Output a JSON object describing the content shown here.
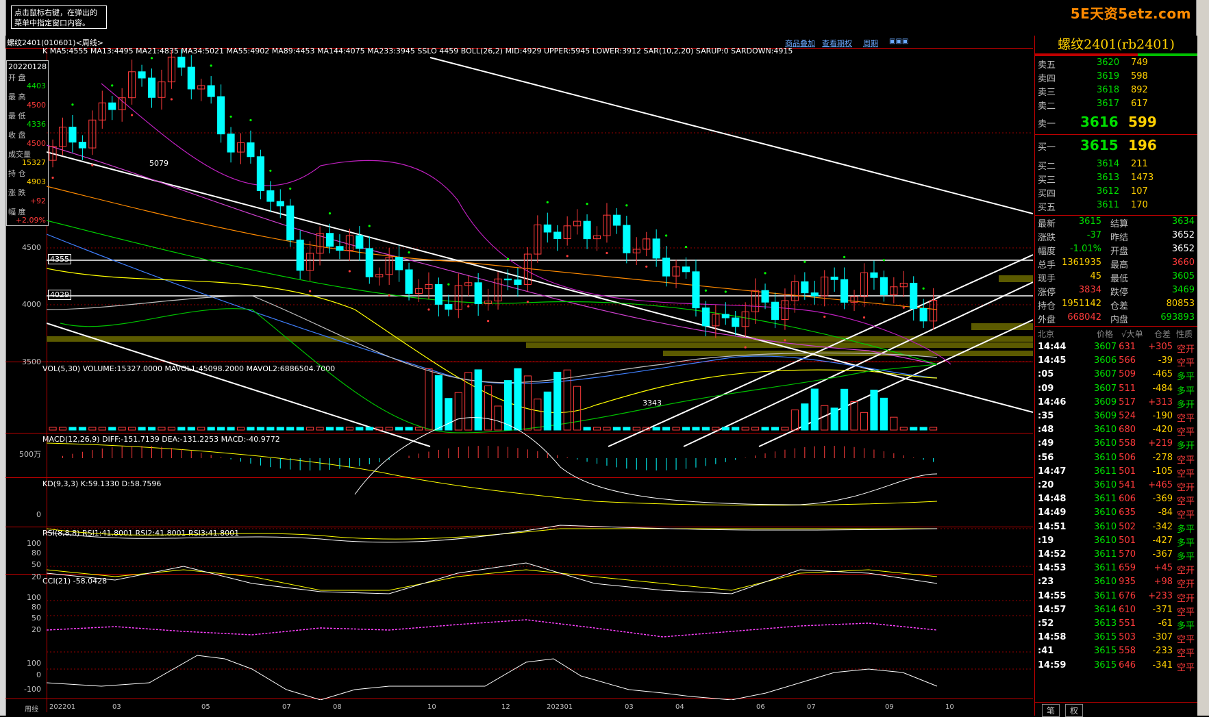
{
  "tip": {
    "text": "点击鼠标右键，在弹出的菜单中指定窗口内容。"
  },
  "logo": "5E天资5etz.com",
  "titlebar": {
    "title": "螺纹2401(010601)<周线>",
    "links": [
      "商品叠加",
      "查看期权",
      "周期"
    ]
  },
  "indicators": {
    "main": "K  MA5:4555  MA13:4495  MA21:4835  MA34:5021  MA55:4902  MA89:4453  MA144:4075  MA233:3945  SSLO 4459  BOLL(26,2)  MID:4929  UPPER:5945  LOWER:3912  SAR(10,2,20)  SARUP:0  SARDOWN:4915",
    "vol": "VOL(5,30)  VOLUME:15327.0000  MAVOL1:45098.2000  MAVOL2:6886504.7000",
    "macd": "MACD(12,26,9)  DIFF:-151.7139  DEA:-131.2253  MACD:-40.9772",
    "kd": "KD(9,3,3)  K:59.1330  D:58.7596",
    "rsi": "RSI(8,8,8)  RSI1:41.8001  RSI2:41.8001  RSI3:41.8001",
    "cci": "CCI(21)  -58.0428"
  },
  "infobox": {
    "date": "20220128",
    "rows": [
      {
        "label": "开  盘",
        "value": "4403"
      },
      {
        "label": "最  高",
        "value": "4500"
      },
      {
        "label": "最  低",
        "value": "4336"
      },
      {
        "label": "收  盘",
        "value": "4500"
      },
      {
        "label": "成交量",
        "value": "15327"
      },
      {
        "label": "持  仓",
        "value": "4903"
      },
      {
        "label": "涨  跌",
        "value": "+92"
      },
      {
        "label": "幅  度",
        "value": "+2.09%"
      }
    ]
  },
  "price_axis": [
    "4500",
    "4000",
    "3500"
  ],
  "price_tags": [
    "4355",
    "4029"
  ],
  "chart_annotations": [
    "5079",
    "3343"
  ],
  "vol_axis": "500万",
  "macd_axis": "0",
  "kd_axis": [
    "100",
    "80",
    "50",
    "20"
  ],
  "rsi_axis": [
    "100",
    "80",
    "50",
    "20"
  ],
  "cci_axis": [
    "100",
    "0",
    "-100"
  ],
  "time_axis": [
    "202201",
    "03",
    "05",
    "07",
    "08",
    "10",
    "12",
    "202301",
    "03",
    "04",
    "06",
    "07",
    "09",
    "10"
  ],
  "time_axis_label": "周线",
  "right_panel": {
    "title": "螺纹2401(rb2401)",
    "asks": [
      {
        "label": "卖五",
        "price": "3620",
        "vol": "749"
      },
      {
        "label": "卖四",
        "price": "3619",
        "vol": "598"
      },
      {
        "label": "卖三",
        "price": "3618",
        "vol": "892"
      },
      {
        "label": "卖二",
        "price": "3617",
        "vol": "617"
      },
      {
        "label": "卖一",
        "price": "3616",
        "vol": "599"
      }
    ],
    "bids": [
      {
        "label": "买一",
        "price": "3615",
        "vol": "196"
      },
      {
        "label": "买二",
        "price": "3614",
        "vol": "211"
      },
      {
        "label": "买三",
        "price": "3613",
        "vol": "1473"
      },
      {
        "label": "买四",
        "price": "3612",
        "vol": "107"
      },
      {
        "label": "买五",
        "price": "3611",
        "vol": "170"
      }
    ],
    "stats": [
      {
        "l1": "最新",
        "v1": "3615",
        "l2": "结算",
        "v2": "3634"
      },
      {
        "l1": "涨跌",
        "v1": "-37",
        "l2": "昨结",
        "v2": "3652"
      },
      {
        "l1": "幅度",
        "v1": "-1.01%",
        "l2": "开盘",
        "v2": "3652"
      },
      {
        "l1": "总手",
        "v1": "1361935",
        "l2": "最高",
        "v2": "3660"
      },
      {
        "l1": "现手",
        "v1": "45",
        "l2": "最低",
        "v2": "3605"
      },
      {
        "l1": "涨停",
        "v1": "3834",
        "l2": "跌停",
        "v2": "3469"
      },
      {
        "l1": "持仓",
        "v1": "1951142",
        "l2": "仓差",
        "v2": "80853"
      },
      {
        "l1": "外盘",
        "v1": "668042",
        "l2": "内盘",
        "v2": "693893"
      }
    ],
    "ticks_header": [
      "北京",
      "价格",
      "√大单",
      "仓差",
      "性质"
    ],
    "ticks": [
      {
        "time": "14:44",
        "price": "3607",
        "vol": "631",
        "diff": "+305",
        "nature": "空开"
      },
      {
        "time": "14:45",
        "price": "3606",
        "vol": "566",
        "diff": "-39",
        "nature": "空平"
      },
      {
        "time": ":05",
        "price": "3607",
        "vol": "509",
        "diff": "-465",
        "nature": "多平"
      },
      {
        "time": ":09",
        "price": "3607",
        "vol": "511",
        "diff": "-484",
        "nature": "多平"
      },
      {
        "time": "14:46",
        "price": "3609",
        "vol": "517",
        "diff": "+313",
        "nature": "多开"
      },
      {
        "time": ":35",
        "price": "3609",
        "vol": "524",
        "diff": "-190",
        "nature": "空平"
      },
      {
        "time": ":48",
        "price": "3610",
        "vol": "680",
        "diff": "-420",
        "nature": "空平"
      },
      {
        "time": ":49",
        "price": "3610",
        "vol": "558",
        "diff": "+219",
        "nature": "多开"
      },
      {
        "time": ":56",
        "price": "3610",
        "vol": "506",
        "diff": "-278",
        "nature": "空平"
      },
      {
        "time": "14:47",
        "price": "3611",
        "vol": "501",
        "diff": "-105",
        "nature": "空平"
      },
      {
        "time": ":20",
        "price": "3610",
        "vol": "541",
        "diff": "+465",
        "nature": "空开"
      },
      {
        "time": "14:48",
        "price": "3611",
        "vol": "606",
        "diff": "-369",
        "nature": "空平"
      },
      {
        "time": "14:49",
        "price": "3610",
        "vol": "635",
        "diff": "-84",
        "nature": "空平"
      },
      {
        "time": "14:51",
        "price": "3610",
        "vol": "502",
        "diff": "-342",
        "nature": "多平"
      },
      {
        "time": ":19",
        "price": "3610",
        "vol": "501",
        "diff": "-427",
        "nature": "多平"
      },
      {
        "time": "14:52",
        "price": "3611",
        "vol": "570",
        "diff": "-367",
        "nature": "多平"
      },
      {
        "time": "14:53",
        "price": "3611",
        "vol": "659",
        "diff": "+45",
        "nature": "空开"
      },
      {
        "time": ":23",
        "price": "3610",
        "vol": "935",
        "diff": "+98",
        "nature": "空开"
      },
      {
        "time": "14:55",
        "price": "3611",
        "vol": "676",
        "diff": "+233",
        "nature": "空开"
      },
      {
        "time": "14:57",
        "price": "3614",
        "vol": "610",
        "diff": "-371",
        "nature": "空平"
      },
      {
        "time": ":52",
        "price": "3613",
        "vol": "551",
        "diff": "-61",
        "nature": "多平"
      },
      {
        "time": "14:58",
        "price": "3615",
        "vol": "503",
        "diff": "-307",
        "nature": "空平"
      },
      {
        "time": ":41",
        "price": "3615",
        "vol": "558",
        "diff": "-233",
        "nature": "空平"
      },
      {
        "time": "14:59",
        "price": "3615",
        "vol": "646",
        "diff": "-341",
        "nature": "空平"
      }
    ],
    "tabs": [
      "笔",
      "权"
    ]
  },
  "colors": {
    "up": "#ff3b3b",
    "down": "#00ffff",
    "grid": "#c00000",
    "accent": "#ffd000"
  },
  "chart_data": {
    "type": "candlestick",
    "x": [
      "2022-01",
      "2022-02",
      "2022-03",
      "2022-04",
      "2022-05",
      "2022-06",
      "2022-07",
      "2022-08",
      "2022-09",
      "2022-10",
      "2022-11",
      "2022-12",
      "2023-01",
      "2023-02",
      "2023-03",
      "2023-04",
      "2023-05",
      "2023-06",
      "2023-07",
      "2023-08",
      "2023-09",
      "2023-10"
    ],
    "close": [
      4500,
      4700,
      4900,
      5000,
      4700,
      4300,
      3900,
      4000,
      3800,
      3700,
      3650,
      3800,
      4100,
      4050,
      4000,
      3750,
      3500,
      3650,
      3700,
      3750,
      3720,
      3615
    ],
    "ylim": [
      3300,
      5100
    ]
  }
}
